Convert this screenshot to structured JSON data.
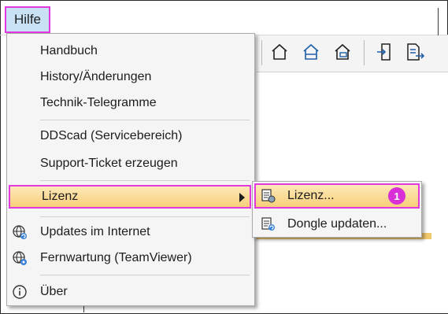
{
  "menubar": {
    "help_label": "Hilfe"
  },
  "menu": {
    "items": [
      {
        "label": "Handbuch"
      },
      {
        "label": "History/Änderungen"
      },
      {
        "label": "Technik-Telegramme"
      },
      {
        "label": "DDScad (Servicebereich)"
      },
      {
        "label": "Support-Ticket erzeugen"
      },
      {
        "label": "Lizenz"
      },
      {
        "label": "Updates im Internet",
        "icon": "globe-refresh-icon"
      },
      {
        "label": "Fernwartung (TeamViewer)",
        "icon": "globe-network-icon"
      },
      {
        "label": "Über",
        "icon": "info-icon"
      }
    ]
  },
  "submenu": {
    "items": [
      {
        "label": "Lizenz...",
        "icon": "license-icon",
        "badge": "1"
      },
      {
        "label": "Dongle updaten...",
        "icon": "dongle-update-icon"
      }
    ]
  },
  "colors": {
    "highlight_border": "#e03adf",
    "active_bg": "#f7cf79",
    "badge_bg": "#d92fd8"
  }
}
